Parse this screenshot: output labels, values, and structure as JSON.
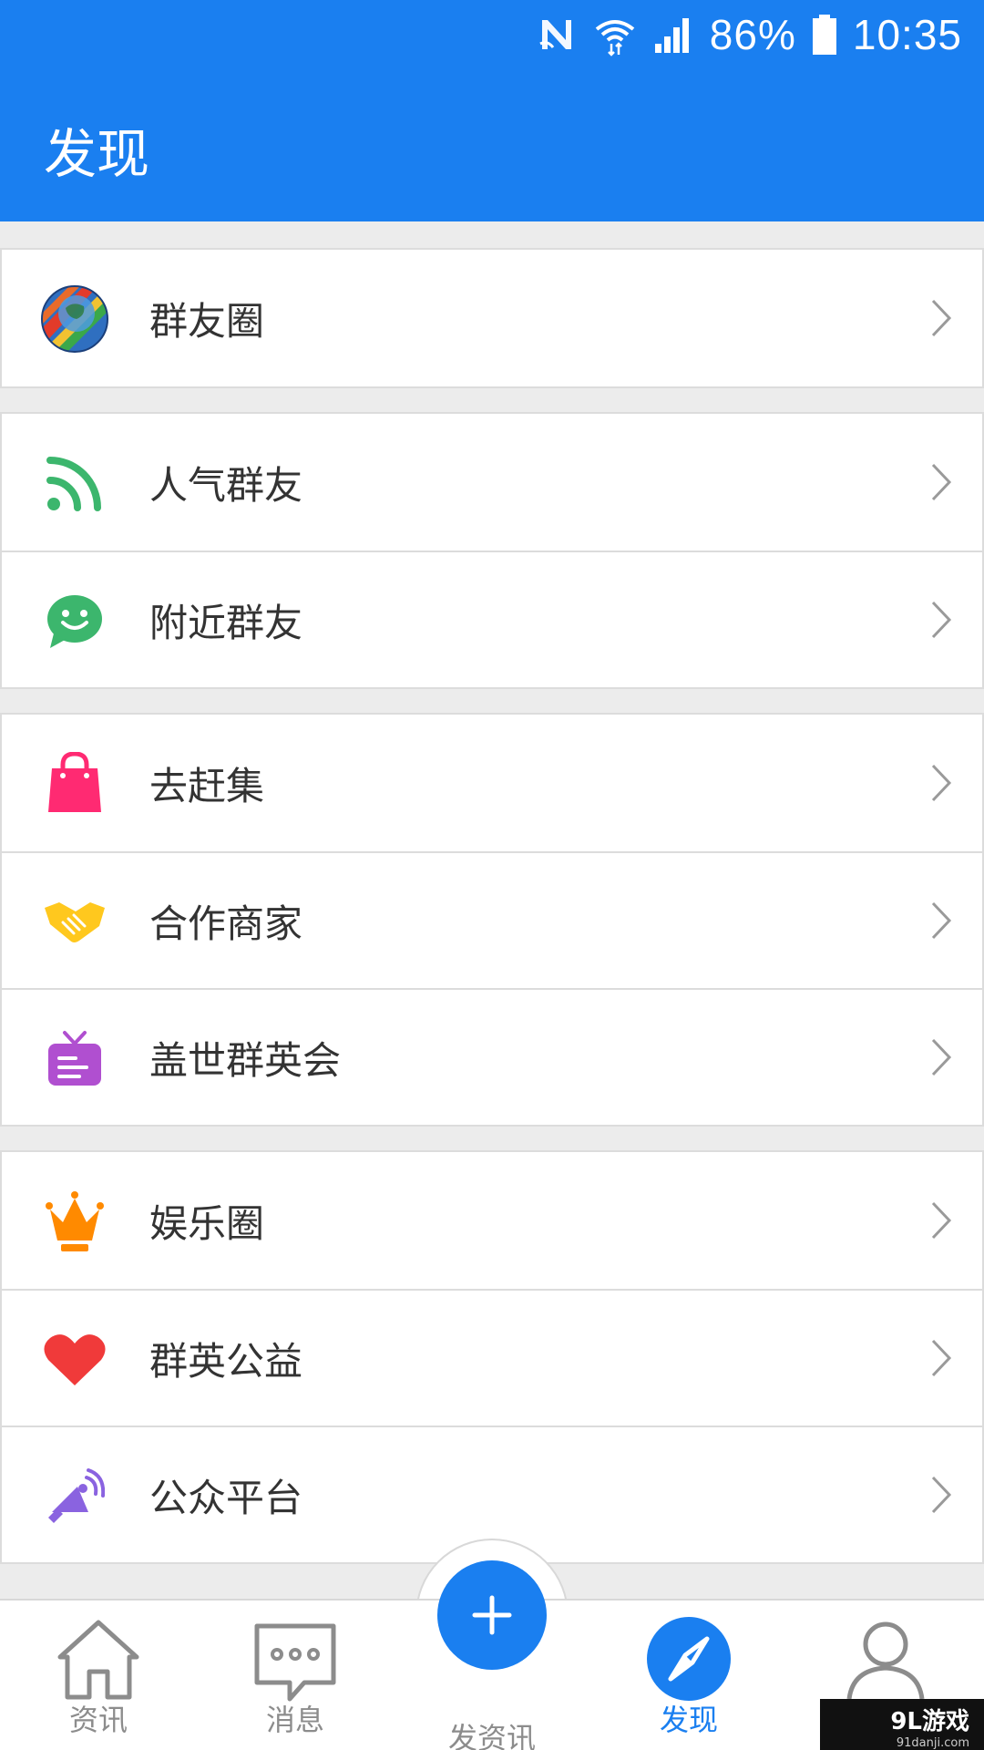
{
  "status_bar": {
    "icons": [
      "nfc-icon",
      "wifi-icon",
      "cellular-signal-icon",
      "battery-icon"
    ],
    "battery": "86%",
    "time": "10:35"
  },
  "header": {
    "title": "发现"
  },
  "sections": [
    {
      "items": [
        {
          "label": "群友圈",
          "icon": "globe-icon"
        }
      ]
    },
    {
      "items": [
        {
          "label": "人气群友",
          "icon": "rss-icon",
          "color": "#3cb66d"
        },
        {
          "label": "附近群友",
          "icon": "smile-chat-icon",
          "color": "#3cb66d"
        }
      ]
    },
    {
      "items": [
        {
          "label": "去赶集",
          "icon": "shopping-bag-icon",
          "color": "#ff2a72"
        },
        {
          "label": "合作商家",
          "icon": "handshake-icon",
          "color": "#ffc81e"
        },
        {
          "label": "盖世群英会",
          "icon": "tv-icon",
          "color": "#b04fd0"
        }
      ]
    },
    {
      "items": [
        {
          "label": "娱乐圈",
          "icon": "crown-icon",
          "color": "#ff8a00"
        },
        {
          "label": "群英公益",
          "icon": "heart-icon",
          "color": "#f03a3a"
        },
        {
          "label": "公众平台",
          "icon": "megaphone-icon",
          "color": "#8a63e0"
        }
      ]
    }
  ],
  "tabbar": {
    "tabs": [
      {
        "label": "资讯",
        "icon": "home-icon"
      },
      {
        "label": "消息",
        "icon": "chat-bubble-icon"
      },
      {
        "label": "发资讯",
        "icon": "plus-icon"
      },
      {
        "label": "发现",
        "icon": "compass-icon",
        "active": true
      },
      {
        "label": "",
        "icon": "user-icon"
      }
    ]
  },
  "watermark": {
    "main": "9L游戏",
    "sub": "91danji.com"
  },
  "colors": {
    "primary": "#1a7ff0",
    "background": "#ececec",
    "text": "#333333",
    "inactive": "#8c8c8c"
  }
}
